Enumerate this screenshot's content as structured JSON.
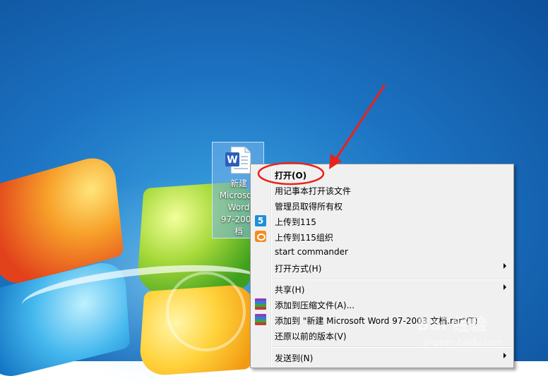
{
  "desktop": {
    "icon": {
      "label": "新建\nMicrosoft\nWord\n97-2003\n档",
      "icon_name": "word-document-icon"
    }
  },
  "context_menu": {
    "items": [
      {
        "label": "打开(O)",
        "bold": true
      },
      {
        "label": "用记事本打开该文件"
      },
      {
        "label": "管理员取得所有权"
      },
      {
        "label": "上传到115",
        "icon": "115-upload-icon"
      },
      {
        "label": "上传到115组织",
        "icon": "115-org-icon"
      },
      {
        "label": "start commander"
      },
      {
        "label": "打开方式(H)",
        "submenu": true
      },
      {
        "label": "共享(H)",
        "submenu": true
      },
      {
        "label": "添加到压缩文件(A)...",
        "icon": "winrar-icon"
      },
      {
        "label": "添加到 \"新建 Microsoft Word 97-2003 文档.rar\"(T)",
        "icon": "winrar-icon"
      },
      {
        "label": "还原以前的版本(V)"
      },
      {
        "label": "发送到(N)",
        "submenu": true
      }
    ]
  },
  "annotation": {
    "color": "#e8231b"
  },
  "watermark": {
    "text": "Bai 经验",
    "sub": "jingyan.baidu.com"
  }
}
